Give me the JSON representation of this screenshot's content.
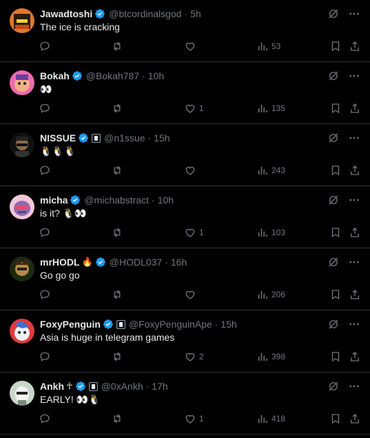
{
  "tweets": [
    {
      "name": "Jawadtoshi",
      "handle": "@btcordinalsgod",
      "time": "5h",
      "text": "The ice is cracking",
      "replies": "",
      "retweets": "",
      "likes": "",
      "views": "53",
      "avatar_color": "#e0782a"
    },
    {
      "name": "Bokah",
      "handle": "@Bokah787",
      "time": "10h",
      "text": "👀",
      "replies": "",
      "retweets": "",
      "likes": "1",
      "views": "135",
      "avatar_color": "#f06ab0"
    },
    {
      "name": "NISSUE",
      "handle": "@n1ssue",
      "time": "15h",
      "text": "🐧🐧🐧",
      "replies": "",
      "retweets": "",
      "likes": "",
      "views": "243",
      "avatar_color": "#2a2a2a"
    },
    {
      "name": "micha",
      "handle": "@michabstract",
      "time": "10h",
      "text": "is it? 🐧👀",
      "replies": "",
      "retweets": "",
      "likes": "1",
      "views": "103",
      "avatar_color": "#d6a3d8"
    },
    {
      "name": "mrHODL",
      "name_emoji": "🔥",
      "handle": "@HODL037",
      "time": "16h",
      "text": "Go go go",
      "replies": "",
      "retweets": "",
      "likes": "",
      "views": "206",
      "avatar_color": "#3a4a2a"
    },
    {
      "name": "FoxyPenguin",
      "handle": "@FoxyPenguinApe",
      "time": "15h",
      "text": "Asia is huge in telegram games",
      "replies": "",
      "retweets": "",
      "likes": "2",
      "views": "398",
      "avatar_color": "#e23b3b"
    },
    {
      "name": "Ankh",
      "name_symbol": "☥",
      "handle": "@0xAnkh",
      "time": "17h",
      "text": "EARLY! 👀🐧",
      "replies": "",
      "retweets": "",
      "likes": "1",
      "views": "418",
      "avatar_color": "#c9d6c9"
    }
  ],
  "dot": "·"
}
